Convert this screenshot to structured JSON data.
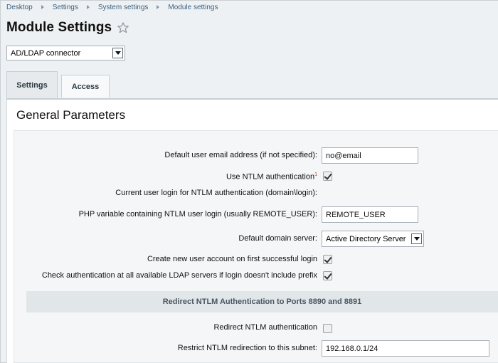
{
  "breadcrumb": [
    "Desktop",
    "Settings",
    "System settings",
    "Module settings"
  ],
  "page_title": "Module Settings",
  "module_select": {
    "value": "AD/LDAP connector"
  },
  "tabs": [
    {
      "label": "Settings",
      "active": true
    },
    {
      "label": "Access",
      "active": false
    }
  ],
  "section_title": "General Parameters",
  "fields": {
    "default_email": {
      "label": "Default user email address (if not specified):",
      "value": "no@email"
    },
    "use_ntlm": {
      "label": "Use NTLM authentication",
      "footnote": "1",
      "checked": true
    },
    "current_login": {
      "label": "Current user login for NTLM authentication (domain\\login):"
    },
    "php_variable": {
      "label": "PHP variable containing NTLM user login (usually REMOTE_USER):",
      "value": "REMOTE_USER"
    },
    "default_domain": {
      "label": "Default domain server:",
      "value": "Active Directory Server"
    },
    "create_account": {
      "label": "Create new user account on first successful login",
      "checked": true
    },
    "check_all_servers": {
      "label": "Check authentication at all available LDAP servers if login doesn't include prefix",
      "checked": true
    },
    "redirect_header": "Redirect NTLM Authentication to Ports 8890 and 8891",
    "redirect_ntlm": {
      "label": "Redirect NTLM authentication",
      "checked": false
    },
    "restrict_subnet": {
      "label": "Restrict NTLM redirection to this subnet:",
      "value": "192.168.0.1/24"
    }
  },
  "colors": {
    "breadcrumb_link": "#3a5f7f",
    "panel_bg": "#f4f6f7",
    "subheader_bg": "#e1e6e9"
  }
}
